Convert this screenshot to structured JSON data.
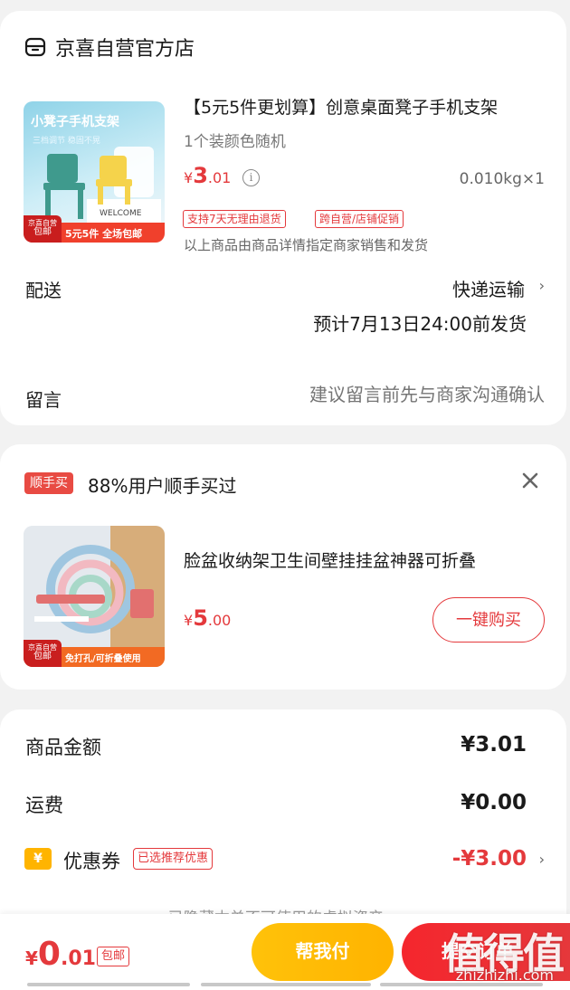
{
  "store": {
    "name": "京喜自营官方店",
    "icon": "store-icon"
  },
  "product": {
    "title": "【5元5件更划算】创意桌面凳子手机支架",
    "spec": "1个装颜色随机",
    "price_symbol": "¥",
    "price_int": "3",
    "price_dec": ".01",
    "weight_qty": "0.010kg×1",
    "tags": [
      "支持7天无理由退货",
      "跨自营/店铺促销"
    ],
    "note": "以上商品由商品详情指定商家销售和发货",
    "thumb": {
      "title": "小凳子手机支架",
      "subtitle": "三档调节 稳固不晃",
      "badge_line1": "京喜自营",
      "badge_line2": "包邮",
      "bottom_text": "5元5件 全场包邮",
      "scene_text": "WELCOME"
    }
  },
  "shipping": {
    "label": "配送",
    "method": "快递运输",
    "eta": "预计7月13日24:00前发货"
  },
  "memo": {
    "label": "留言",
    "placeholder": "建议留言前先与商家沟通确认"
  },
  "upsell": {
    "badge": "顺手买",
    "text": "88%用户顺手买过",
    "product_title": "脸盆收纳架卫生间壁挂挂盆神器可折叠",
    "price_symbol": "¥",
    "price_int": "5",
    "price_dec": ".00",
    "buy_button": "一键购买",
    "thumb": {
      "badge_line1": "京喜自营",
      "badge_line2": "包邮",
      "bottom_text": "免打孔/可折叠使用"
    }
  },
  "summary": {
    "goods_amount_label": "商品金额",
    "goods_amount": "¥3.01",
    "freight_label": "运费",
    "freight": "¥0.00",
    "coupon_icon_char": "¥",
    "coupon_label": "优惠券",
    "coupon_tag": "已选推荐优惠",
    "coupon_value": "-¥3.00",
    "hidden_note": "已隐藏本单不可使用的虚拟资产"
  },
  "bottom": {
    "total_symbol": "¥",
    "total_int": "0",
    "total_dec": ".01",
    "free_shipping": "包邮",
    "help_pay": "帮我付",
    "submit": "提交订单"
  },
  "watermark": {
    "text": "值得值",
    "url": "zhizhizhi.com"
  },
  "colors": {
    "accent_red": "#e4393c",
    "help_pay_yellow": "#ffc20a",
    "coupon_yellow": "#ffb400",
    "background": "#f2f2f2"
  }
}
